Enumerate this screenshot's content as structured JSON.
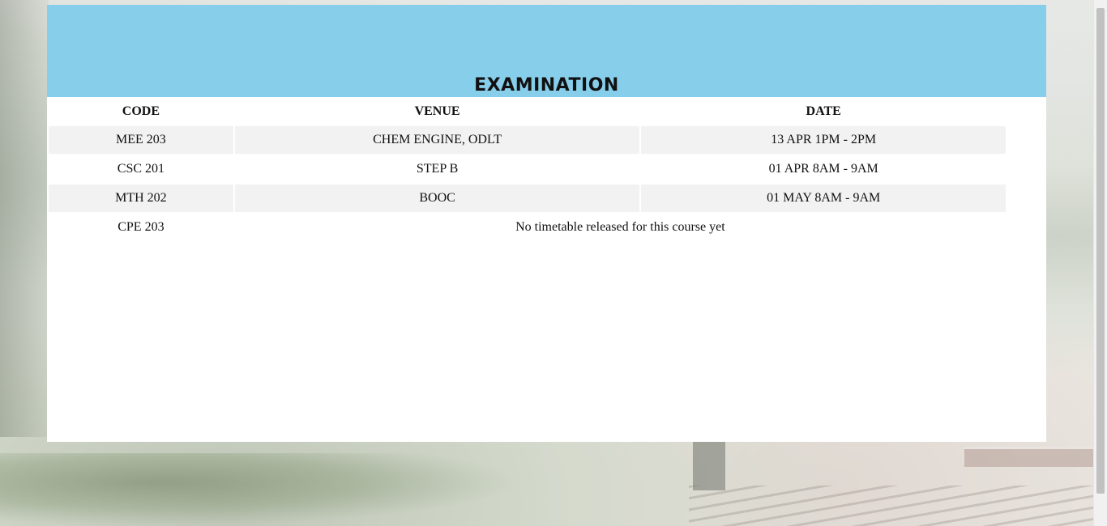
{
  "page": {
    "title": "EXAMINATION"
  },
  "table": {
    "headers": {
      "code": "CODE",
      "venue": "VENUE",
      "date": "DATE"
    },
    "rows": [
      {
        "code": "MEE 203",
        "venue": "CHEM ENGINE, ODLT",
        "date": "13 APR 1PM - 2PM"
      },
      {
        "code": "CSC 201",
        "venue": "STEP B",
        "date": "01 APR 8AM - 9AM"
      },
      {
        "code": "MTH 202",
        "venue": "BOOC",
        "date": "01 MAY 8AM - 9AM"
      }
    ],
    "pending_row": {
      "code": "CPE 203",
      "message": "No timetable released for this course yet"
    }
  },
  "colors": {
    "header_background": "#87ceeb",
    "row_shade": "#f2f2f2"
  }
}
